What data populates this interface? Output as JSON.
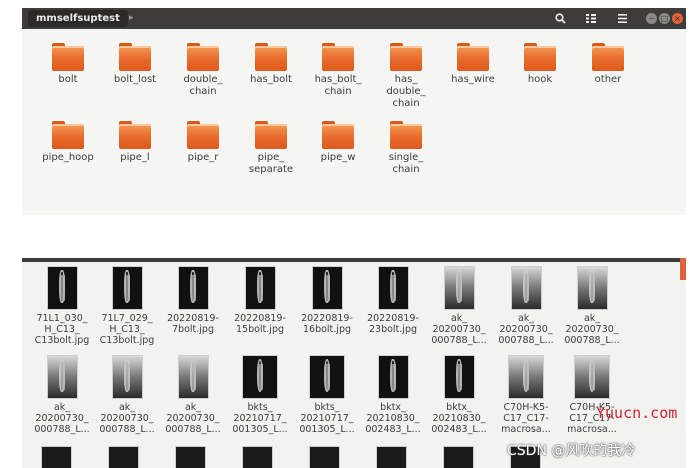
{
  "top_window": {
    "path_title": "mmselfsuptest",
    "path_arrow": "▸",
    "folders": [
      {
        "label": "bolt"
      },
      {
        "label": "bolt_lost"
      },
      {
        "label": "double_\nchain"
      },
      {
        "label": "has_bolt"
      },
      {
        "label": "has_bolt_\nchain"
      },
      {
        "label": "has_\ndouble_\nchain"
      },
      {
        "label": "has_wire"
      },
      {
        "label": "hook"
      },
      {
        "label": "other"
      },
      {
        "label": "pipe_hoop"
      },
      {
        "label": "pipe_l"
      },
      {
        "label": "pipe_r"
      },
      {
        "label": "pipe_\nseparate"
      },
      {
        "label": "pipe_w"
      },
      {
        "label": "single_\nchain"
      }
    ],
    "toolbar": {
      "search_icon": "search-icon",
      "view_icon": "grid-view-icon",
      "menu_icon": "hamburger-menu-icon"
    }
  },
  "bottom_window": {
    "files": [
      {
        "label": "71L1_030_\nH_C13_\nC13bolt.jpg"
      },
      {
        "label": "71L7_029_\nH_C13_\nC13bolt.jpg"
      },
      {
        "label": "20220819-\n7bolt.jpg"
      },
      {
        "label": "20220819-\n15bolt.jpg"
      },
      {
        "label": "20220819-\n16bolt.jpg"
      },
      {
        "label": "20220819-\n23bolt.jpg"
      },
      {
        "label": "ak_\n20200730_\n000788_L..."
      },
      {
        "label": "ak_\n20200730_\n000788_L..."
      },
      {
        "label": "ak_\n20200730_\n000788_L..."
      },
      {
        "label": "ak_\n20200730_\n000788_L..."
      },
      {
        "label": "ak_\n20200730_\n000788_L..."
      },
      {
        "label": "ak_\n20200730_\n000788_L..."
      },
      {
        "label": "bkts_\n20210717_\n001305_L..."
      },
      {
        "label": "bkts_\n20210717_\n001305_L..."
      },
      {
        "label": "bktx_\n20210830_\n002483_L..."
      },
      {
        "label": "bktx_\n20210830_\n002483_L..."
      },
      {
        "label": "C70H-K5-\nC17_C17-\nmacrosa..."
      },
      {
        "label": "C70H-K5-\nC17_C17-\nmacrosa..."
      }
    ]
  },
  "watermarks": {
    "site": "Yuucn.com",
    "csdn": "CSDN @风吹的我冷"
  },
  "colors": {
    "titlebar": "#3d3c38",
    "folder_orange": "#e8692a",
    "close_button": "#e0623a",
    "watermark_red": "#d2232a"
  }
}
